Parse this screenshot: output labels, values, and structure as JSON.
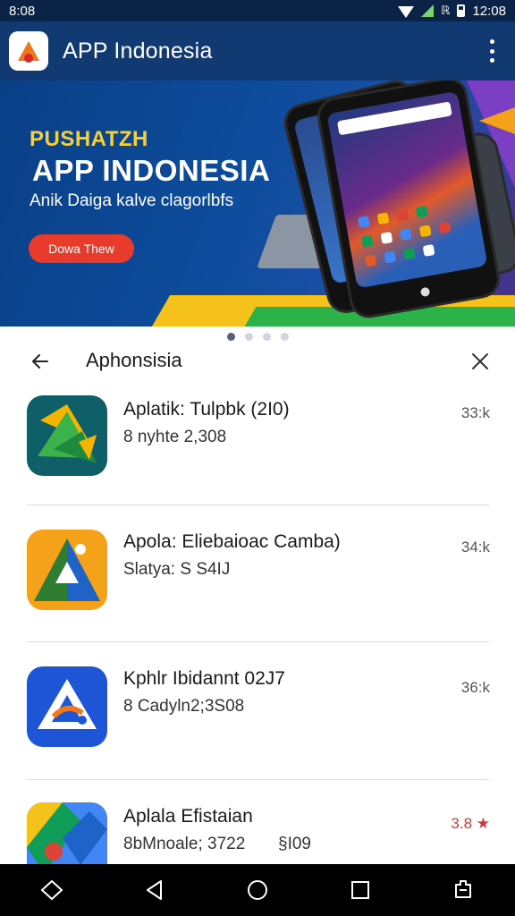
{
  "status_bar": {
    "time": "8:08",
    "signal_label": "ℝ",
    "clock_right": "12:08"
  },
  "app_bar": {
    "title": "APP Indonesia"
  },
  "banner": {
    "kicker": "PUSHATZH",
    "title": "APP INDONESIA",
    "subtitle": "Anik Daiga kalve clagorlbfs",
    "cta_label": "Dowa Thew",
    "colors": {
      "background": "#0d4c9c",
      "kicker": "#f2d13a",
      "cta": "#e83b2c"
    }
  },
  "carousel": {
    "total": 4,
    "active_index": 0
  },
  "search": {
    "query": "Aphonsisia"
  },
  "results": [
    {
      "name": "Aplatik: Tulpbk (2I0)",
      "meta": "8 nyhte 2,308",
      "meta_extra": "",
      "rating": "33:k",
      "icon": "green-triangle-app-icon",
      "hot": false
    },
    {
      "name": "Apola: Eliebaioac Camba)",
      "meta": "Slatya: S S4IJ",
      "meta_extra": "",
      "rating": "34:k",
      "icon": "orange-triangle-app-icon",
      "hot": false
    },
    {
      "name": "Kphlr Ibidannt 02J7",
      "meta": "8 Cadyln2;3S08",
      "meta_extra": "",
      "rating": "36:k",
      "icon": "blue-triangle-app-icon",
      "hot": false
    },
    {
      "name": "Aplala Efistaian",
      "meta": "8bMnoale; 3722",
      "meta_extra": "§I09",
      "rating": "3.8 ★",
      "icon": "multicolor-app-icon",
      "hot": true
    }
  ],
  "nav": {
    "buttons": [
      "diamond-icon",
      "back-triangle-icon",
      "home-circle-icon",
      "recents-square-icon",
      "screenshot-icon"
    ]
  }
}
